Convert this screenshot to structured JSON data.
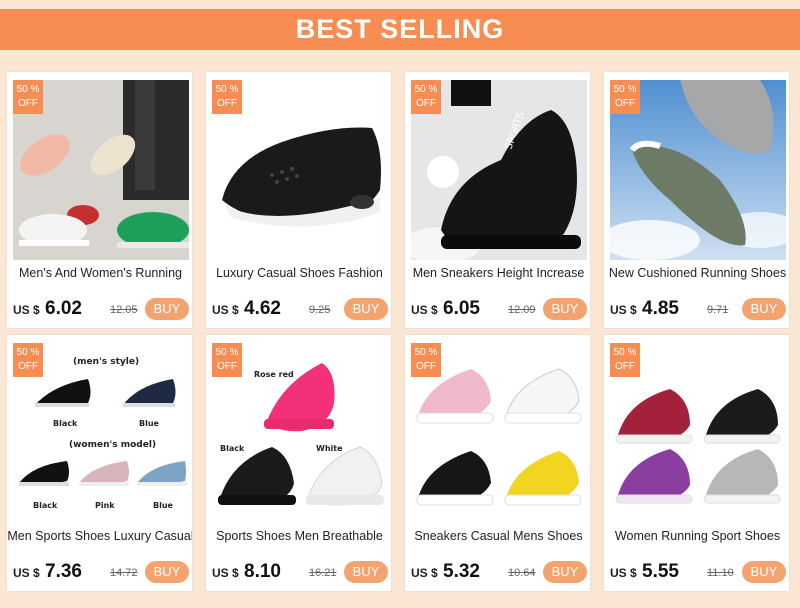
{
  "banner": {
    "title": "BEST SELLING"
  },
  "colors": {
    "accent": "#f78d52",
    "buy_button": "#f5a36e",
    "background": "#fbe6d3"
  },
  "products": [
    {
      "badge": "50 %\nOFF",
      "title": "Men's And Women's Running",
      "currency": "US $",
      "price": "6.02",
      "old_price": "12.05",
      "buy": "BUY"
    },
    {
      "badge": "50 %\nOFF",
      "title": "Luxury Casual Shoes Fashion",
      "currency": "US $",
      "price": "4.62",
      "old_price": "9.25",
      "buy": "BUY"
    },
    {
      "badge": "50 %\nOFF",
      "title": "Men Sneakers Height Increase",
      "currency": "US $",
      "price": "6.05",
      "old_price": "12.09",
      "buy": "BUY"
    },
    {
      "badge": "50 %\nOFF",
      "title": "New Cushioned Running Shoes",
      "currency": "US $",
      "price": "4.85",
      "old_price": "9.71",
      "buy": "BUY"
    },
    {
      "badge": "50 %\nOFF",
      "title": "Men Sports Shoes Luxury Casual",
      "currency": "US $",
      "price": "7.36",
      "old_price": "14.72",
      "buy": "BUY",
      "image_text": {
        "top": "(men's style)",
        "a": "Black",
        "b": "Blue",
        "mid": "(women's model)",
        "c": "Black",
        "d": "Pink",
        "e": "Blue"
      }
    },
    {
      "badge": "50 %\nOFF",
      "title": "Sports Shoes Men Breathable",
      "currency": "US $",
      "price": "8.10",
      "old_price": "16.21",
      "buy": "BUY",
      "image_text": {
        "a": "Rose red",
        "b": "Black",
        "c": "White"
      }
    },
    {
      "badge": "50 %\nOFF",
      "title": "Sneakers Casual Mens Shoes",
      "currency": "US $",
      "price": "5.32",
      "old_price": "10.64",
      "buy": "BUY"
    },
    {
      "badge": "50 %\nOFF",
      "title": "Women Running Sport Shoes",
      "currency": "US $",
      "price": "5.55",
      "old_price": "11.10",
      "buy": "BUY"
    }
  ]
}
